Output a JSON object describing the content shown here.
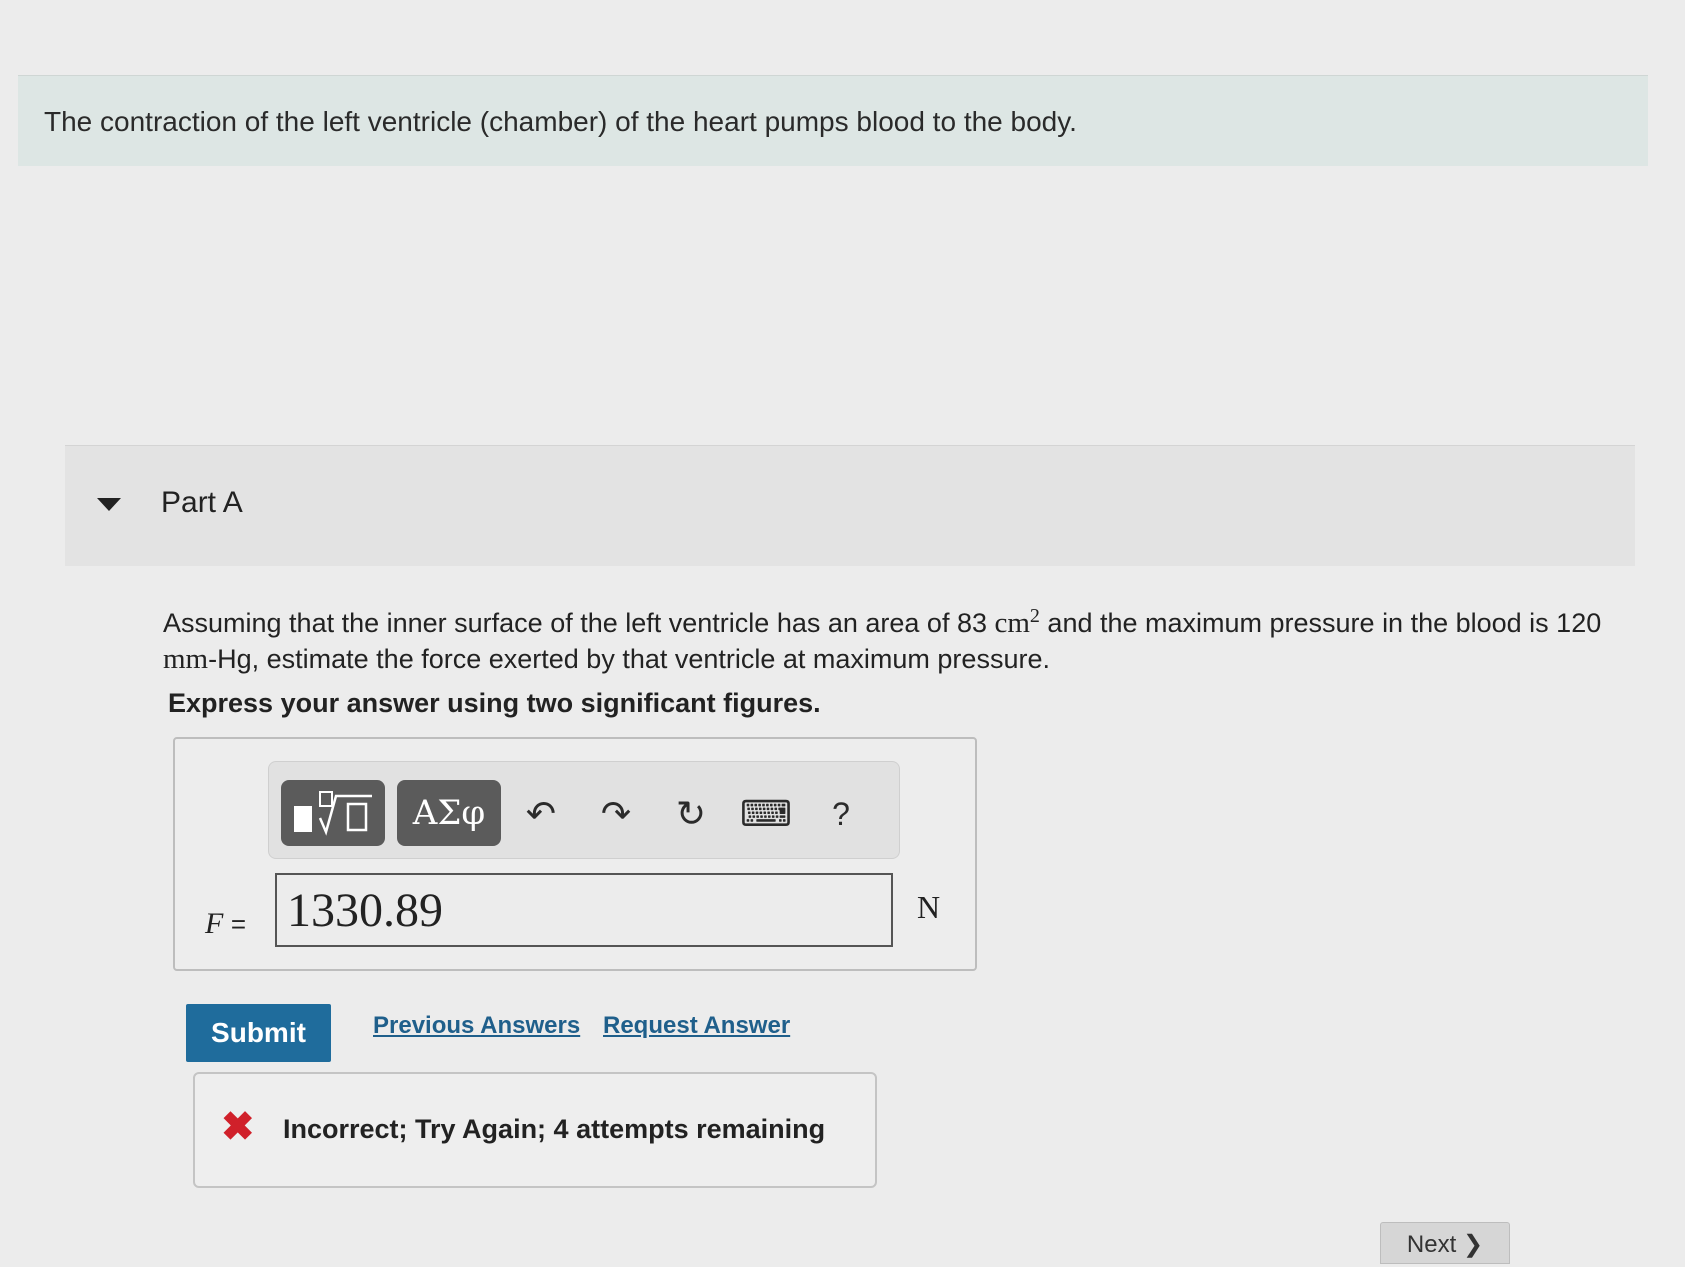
{
  "intro": {
    "text": "The contraction of the left ventricle (chamber) of the heart pumps blood to the body."
  },
  "part": {
    "title": "Part A"
  },
  "question": {
    "text_1": "Assuming that the inner surface of the left ventricle has an area of 83 ",
    "unit_area": "cm",
    "unit_area_exp": "2",
    "text_2": " and the maximum pressure in the blood is 120 ",
    "unit_pressure": "mm",
    "text_3": "-Hg, estimate the force exerted by that ventricle at maximum pressure.",
    "instruction": "Express your answer using two significant figures."
  },
  "toolbar": {
    "templates_label": "√",
    "symbols_label": "ΑΣφ",
    "undo_icon": "↶",
    "redo_icon": "↷",
    "reset_icon": "↻",
    "keyboard_icon": "⌨",
    "help_label": "?"
  },
  "answer": {
    "variable": "F",
    "equals": "=",
    "value": "1330.89",
    "unit": "N"
  },
  "actions": {
    "submit_label": "Submit",
    "previous_answers_label": "Previous Answers",
    "request_answer_label": "Request Answer"
  },
  "feedback": {
    "icon": "✖",
    "text": "Incorrect; Try Again; 4 attempts remaining"
  },
  "nav": {
    "next_label": "Next",
    "next_icon": "❯"
  }
}
